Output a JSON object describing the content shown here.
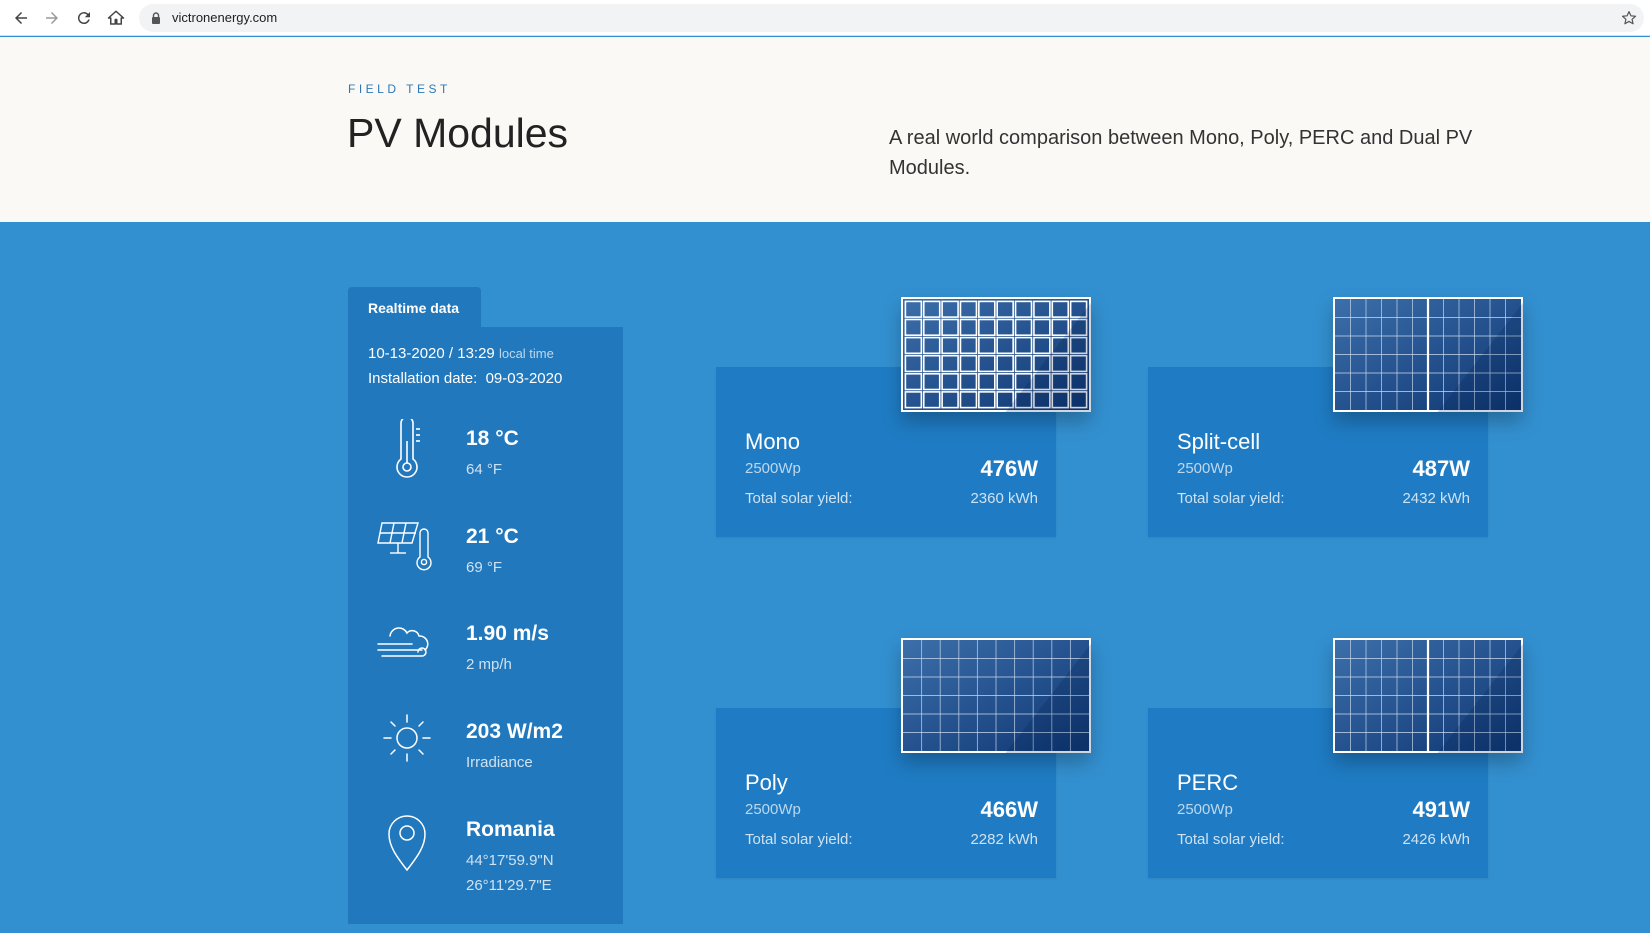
{
  "browser": {
    "url": "victronenergy.com"
  },
  "hero": {
    "eyebrow": "FIELD TEST",
    "title": "PV Modules",
    "tagline": "A real world comparison between Mono, Poly, PERC and Dual PV Modules."
  },
  "realtime": {
    "tab_label": "Realtime data",
    "datetime": "10-13-2020 / 13:29",
    "datetime_suffix": "local time",
    "installation_label": "Installation date:",
    "installation_date": "09-03-2020",
    "rows": [
      {
        "icon": "thermometer-icon",
        "main": "18 °C",
        "sub1": "64 °F",
        "sub2": ""
      },
      {
        "icon": "panel-temperature-icon",
        "main": "21 °C",
        "sub1": "69 °F",
        "sub2": ""
      },
      {
        "icon": "wind-cloud-icon",
        "main": "1.90 m/s",
        "sub1": "2 mp/h",
        "sub2": ""
      },
      {
        "icon": "sun-icon",
        "main": "203 W/m2",
        "sub1": "Irradiance",
        "sub2": ""
      },
      {
        "icon": "location-pin-icon",
        "main": "Romania",
        "sub1": "44°17'59.9\"N",
        "sub2": "26°11'29.7\"E"
      }
    ]
  },
  "modules": [
    {
      "name": "Mono",
      "rating": "2500Wp",
      "power": "476W",
      "yield_label": "Total solar yield:",
      "yield": "2360 kWh",
      "panel_style": "mono"
    },
    {
      "name": "Split-cell",
      "rating": "2500Wp",
      "power": "487W",
      "yield_label": "Total solar yield:",
      "yield": "2432 kWh",
      "panel_style": "split"
    },
    {
      "name": "Poly",
      "rating": "2500Wp",
      "power": "466W",
      "yield_label": "Total solar yield:",
      "yield": "2282 kWh",
      "panel_style": "poly"
    },
    {
      "name": "PERC",
      "rating": "2500Wp",
      "power": "491W",
      "yield_label": "Total solar yield:",
      "yield": "2426 kWh",
      "panel_style": "split"
    }
  ],
  "colors": {
    "page_background": "#3390d0",
    "panel_background": "#2278bc",
    "card_background": "#1f7cc4",
    "hero_background": "#faf9f5",
    "accent": "#2e78b7"
  }
}
